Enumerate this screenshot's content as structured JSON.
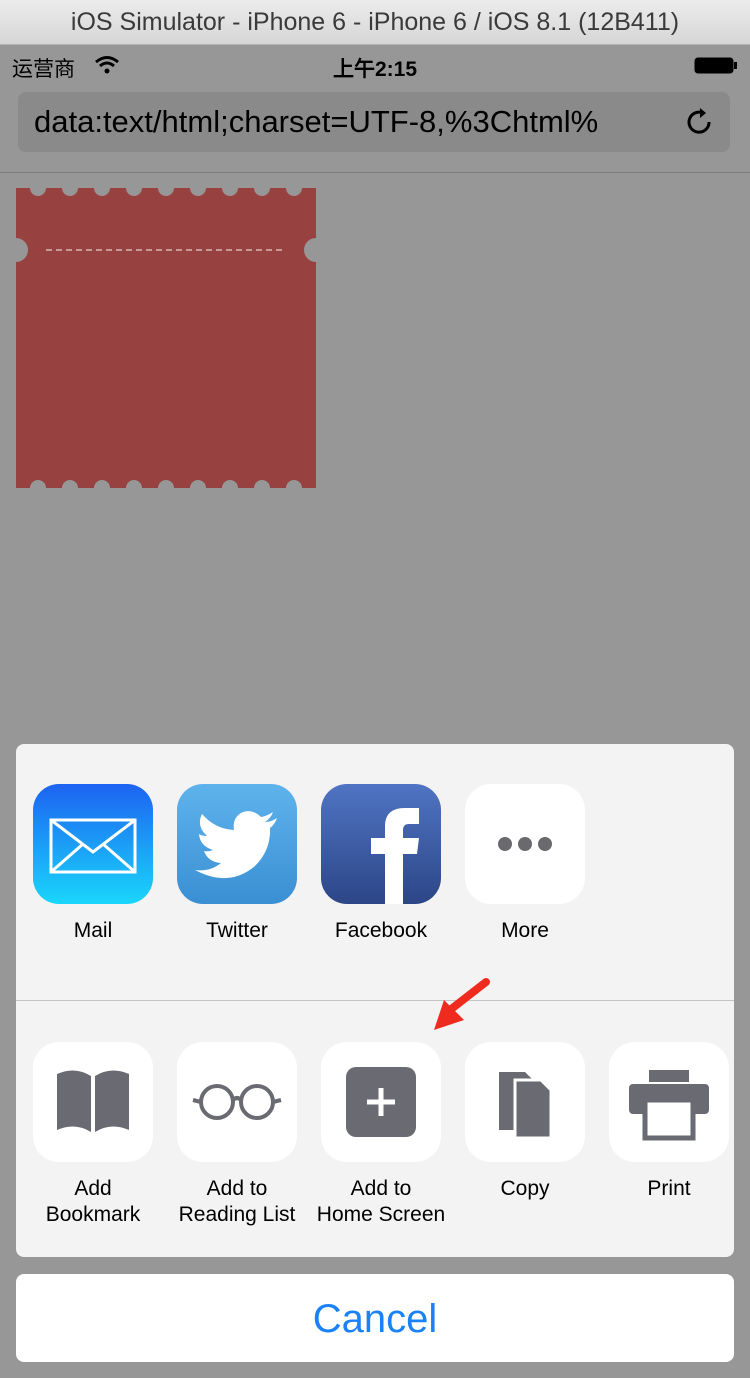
{
  "window": {
    "title": "iOS Simulator - iPhone 6 - iPhone 6 / iOS 8.1 (12B411)"
  },
  "status_bar": {
    "carrier": "运营商",
    "time": "上午2:15"
  },
  "address_bar": {
    "url": "data:text/html;charset=UTF-8,%3Chtml%"
  },
  "colors": {
    "ticket": "#974240",
    "cancel_text": "#1a82f6",
    "arrow": "#ee2b1e"
  },
  "share_sheet": {
    "apps": [
      {
        "label": "Mail",
        "icon": "mail-icon"
      },
      {
        "label": "Twitter",
        "icon": "twitter-icon"
      },
      {
        "label": "Facebook",
        "icon": "facebook-icon"
      },
      {
        "label": "More",
        "icon": "more-icon"
      }
    ],
    "actions": [
      {
        "line1": "Add",
        "line2": "Bookmark",
        "icon": "book-icon"
      },
      {
        "line1": "Add to",
        "line2": "Reading List",
        "icon": "glasses-icon"
      },
      {
        "line1": "Add to",
        "line2": "Home Screen",
        "icon": "add-square-icon"
      },
      {
        "line1": "Copy",
        "line2": "",
        "icon": "copy-icon"
      },
      {
        "line1": "Print",
        "line2": "",
        "icon": "printer-icon"
      }
    ],
    "cancel": "Cancel"
  }
}
